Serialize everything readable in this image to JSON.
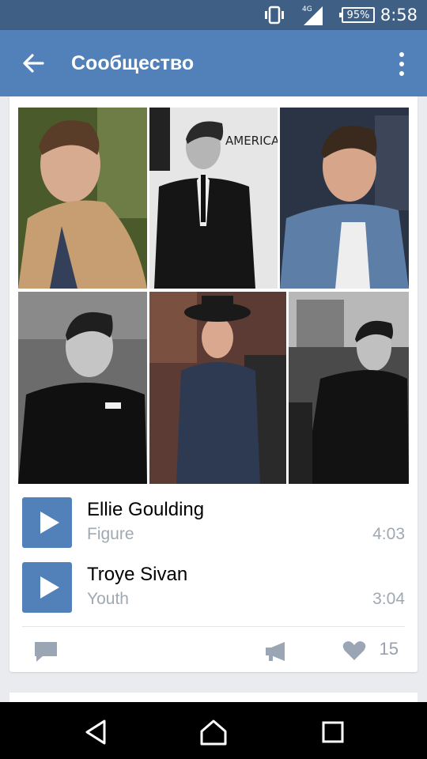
{
  "status": {
    "network": "4G",
    "battery": "95%",
    "time": "8:58",
    "icons": [
      "vibrate-icon",
      "signal-icon",
      "battery-icon"
    ]
  },
  "appbar": {
    "title": "Сообщество",
    "back_icon": "arrow-back-icon",
    "menu_icon": "more-vertical-icon",
    "color": "#5181b8"
  },
  "post": {
    "photos": [
      "photo-1",
      "photo-2",
      "photo-3",
      "photo-4",
      "photo-5",
      "photo-6"
    ],
    "tracks": [
      {
        "artist": "Ellie Goulding",
        "title": "Figure",
        "duration": "4:03"
      },
      {
        "artist": "Troye Sivan",
        "title": "Youth",
        "duration": "3:04"
      }
    ],
    "actions": {
      "comment_icon": "comment-icon",
      "share_icon": "megaphone-icon",
      "like_icon": "heart-icon",
      "likes_count": "15"
    }
  },
  "navbar": {
    "buttons": [
      "back-triangle-icon",
      "home-icon",
      "recents-square-icon"
    ]
  },
  "colors": {
    "accent": "#5181b8",
    "statusbar": "#3f5f85",
    "secondary_text": "#a0a8b2"
  }
}
